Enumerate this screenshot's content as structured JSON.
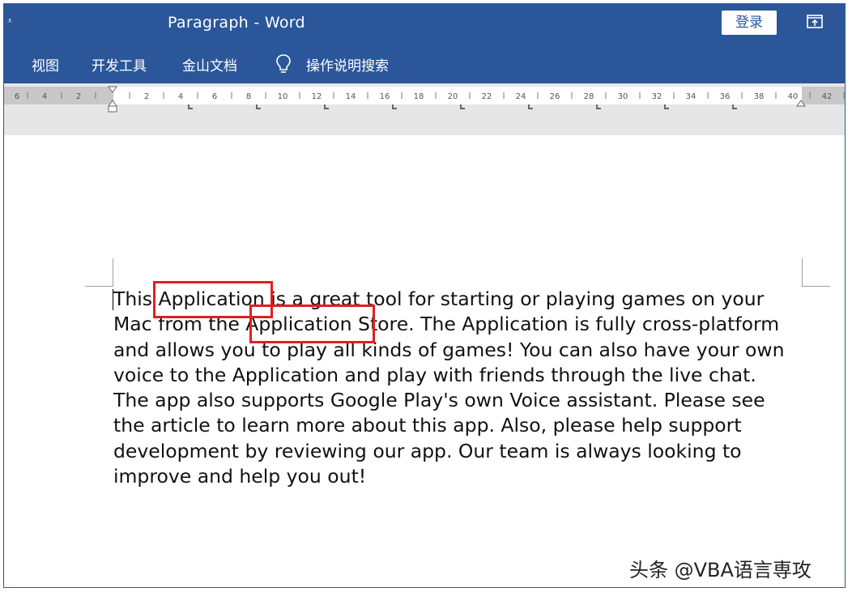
{
  "window": {
    "title": "Paragraph  -  Word",
    "login_label": "登录",
    "qat_glyph": "⩡"
  },
  "ribbon": {
    "tabs": [
      "视图",
      "开发工具",
      "金山文档"
    ],
    "tell_me": "操作说明搜索"
  },
  "ruler": {
    "labels": [
      "6",
      "4",
      "2",
      "2",
      "4",
      "6",
      "8",
      "10",
      "12",
      "14",
      "16",
      "18",
      "20",
      "22",
      "24",
      "26",
      "28",
      "30",
      "32",
      "34",
      "36",
      "38",
      "40",
      "42"
    ]
  },
  "document": {
    "paragraphs": [
      "This Application is a great tool for starting or playing games on your Mac from the Application Store. The Application is fully cross-platform and allows you to play all kinds of games! You can also have your own voice to the Application and play with friends through the live chat.",
      "The app also supports Google Play's own Voice assistant. Please see the article to learn more about this app. Also, please help support development by reviewing our app. Our team is always looking to improve and help you out!"
    ]
  },
  "watermark": "头条 @VBA语言専攻",
  "colors": {
    "accent": "#2b579a",
    "highlight": "#e02020"
  }
}
